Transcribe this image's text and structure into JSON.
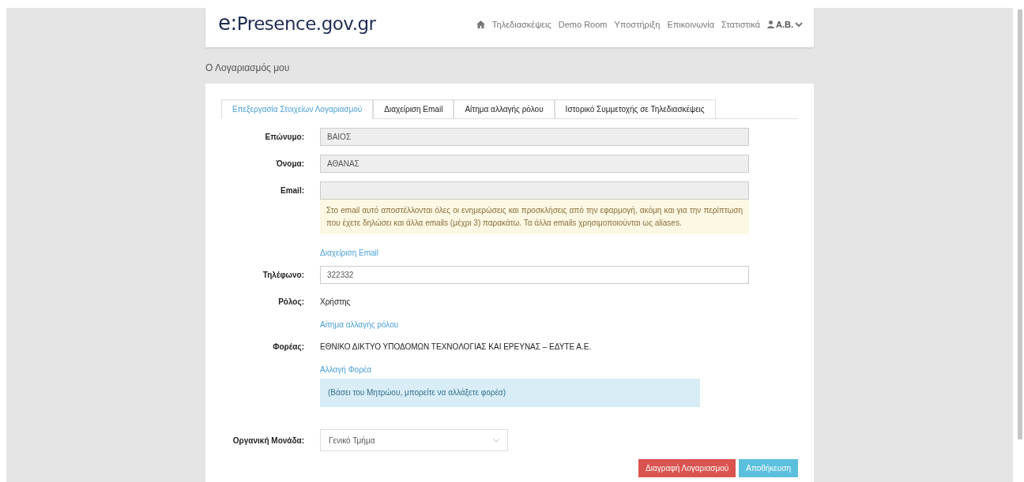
{
  "header": {
    "logo_prefix": "e:",
    "logo_rest": "Presence.gov.gr",
    "nav": [
      "Τηλεδιασκέψεις",
      "Demo Room",
      "Υποστήριξη",
      "Επικοινωνία",
      "Στατιστικά"
    ],
    "user": "A.B."
  },
  "breadcrumb": "Ο Λογαριασμός μου",
  "tabs": [
    {
      "label": "Επεξεργασία Στοιχείων Λογαριασμού",
      "selected": true
    },
    {
      "label": "Διαχείριση Email",
      "selected": false
    },
    {
      "label": "Αίτημα αλλαγής ρόλου",
      "selected": false
    },
    {
      "label": "Ιστορικό Συμμετοχής σε Τηλεδιασκέψεις",
      "selected": false
    }
  ],
  "rows": [
    {
      "kind": "field",
      "label": "Επώνυμο:",
      "value": "ΒΑΙΟΣ",
      "disabled": true
    },
    {
      "kind": "field",
      "label": "Όνομα:",
      "value": "ΑΘΑΝΑΣ",
      "disabled": true
    },
    {
      "kind": "field",
      "label": "Email:",
      "disabled": true
    },
    {
      "kind": "warning",
      "text": "Στο email αυτό αποστέλλονται όλες οι ενημερώσεις και προσκλήσεις από την εφαρμογή, ακόμη και για την περίπτωση που έχετε δηλώσει και άλλα emails (μέχρι 3) παρακάτω. Τα άλλα emails χρησιμοποιούνται ως aliases."
    },
    {
      "kind": "link",
      "text": "Διαχείριση Email"
    },
    {
      "kind": "field",
      "label": "Τηλέφωνο:",
      "value": "322332",
      "disabled": false
    },
    {
      "kind": "text",
      "label": "Ρόλος:",
      "text": "Χρήστης"
    },
    {
      "kind": "link",
      "text": "Αίτημα αλλαγής ρόλου"
    },
    {
      "kind": "text",
      "label": "Φορέας:",
      "text": "ΕΘΝΙΚΟ ΔΙΚΤΥΟ ΥΠΟΔΟΜΩΝ ΤΕΧΝΟΛΟΓΙΑΣ ΚΑΙ ΕΡΕΥΝΑΣ – ΕΔΥΤΕ Α.Ε."
    },
    {
      "kind": "link",
      "text": "Αλλαγή Φορέα"
    },
    {
      "kind": "info",
      "text": "(Βάσει του Μητρώου, μπορείτε να αλλάξετε φορέα)"
    },
    {
      "kind": "select",
      "label": "Οργανική Μονάδα:",
      "value": "Γενικό Τμήμα"
    }
  ],
  "buttons": [
    {
      "kind": "danger",
      "label": "Διαγραφή Λογαριασμού"
    },
    {
      "kind": "primary",
      "label": "Αποθήκευση"
    }
  ]
}
